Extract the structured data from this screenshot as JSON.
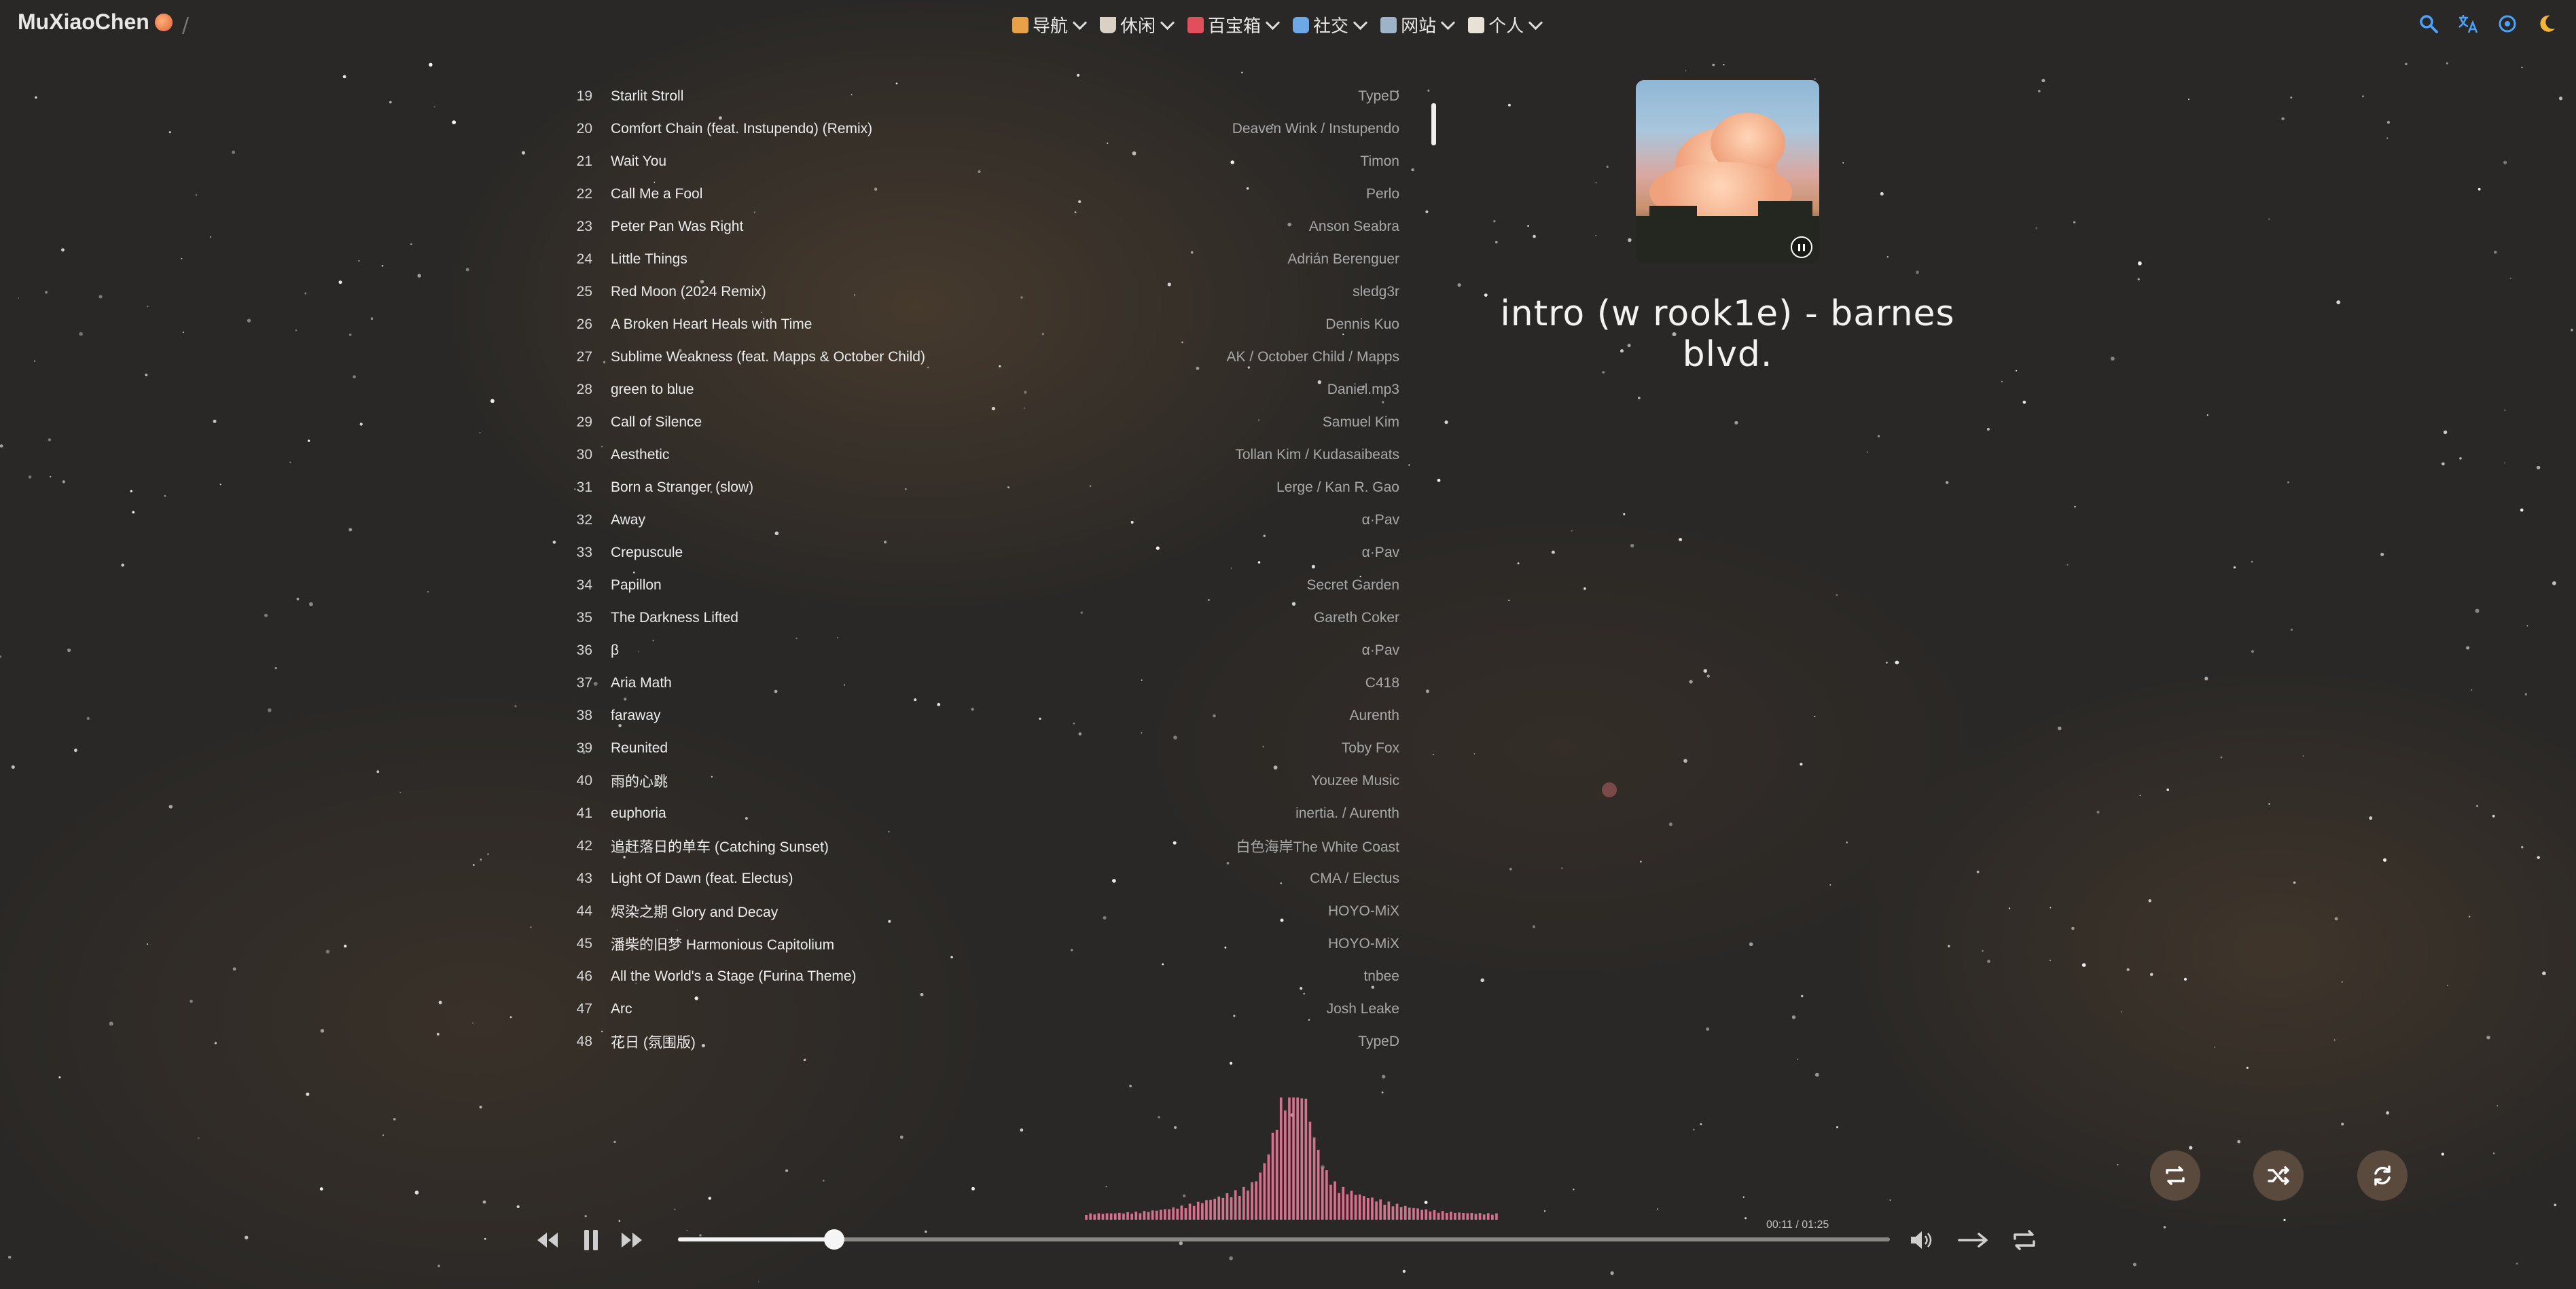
{
  "brand": {
    "name": "MuXiaoChen"
  },
  "nav": {
    "items": [
      {
        "label": "导航",
        "icon": "compass-icon"
      },
      {
        "label": "休闲",
        "icon": "coffee-icon"
      },
      {
        "label": "百宝箱",
        "icon": "gift-box-icon"
      },
      {
        "label": "社交",
        "icon": "chat-icon"
      },
      {
        "label": "网站",
        "icon": "website-icon"
      },
      {
        "label": "个人",
        "icon": "notebook-icon"
      }
    ],
    "right_icons": [
      "search-icon",
      "translate-icon",
      "settings-icon",
      "moon-icon"
    ]
  },
  "playlist": {
    "tracks": [
      {
        "n": "19",
        "title": "Starlit Stroll",
        "artist": "TypeD"
      },
      {
        "n": "20",
        "title": "Comfort Chain (feat. Instupendo) (Remix)",
        "artist": "Deaven Wink / Instupendo"
      },
      {
        "n": "21",
        "title": "Wait You",
        "artist": "Timon"
      },
      {
        "n": "22",
        "title": "Call Me a Fool",
        "artist": "Perlo"
      },
      {
        "n": "23",
        "title": "Peter Pan Was Right",
        "artist": "Anson Seabra"
      },
      {
        "n": "24",
        "title": "Little Things",
        "artist": "Adrián Berenguer"
      },
      {
        "n": "25",
        "title": "Red Moon (2024 Remix)",
        "artist": "sledg3r"
      },
      {
        "n": "26",
        "title": "A Broken Heart Heals with Time",
        "artist": "Dennis Kuo"
      },
      {
        "n": "27",
        "title": "Sublime Weakness (feat. Mapps & October Child)",
        "artist": "AK / October Child / Mapps"
      },
      {
        "n": "28",
        "title": "green to blue",
        "artist": "Daniel.mp3"
      },
      {
        "n": "29",
        "title": "Call of Silence",
        "artist": "Samuel Kim"
      },
      {
        "n": "30",
        "title": "Aesthetic",
        "artist": "Tollan Kim / Kudasaibeats"
      },
      {
        "n": "31",
        "title": "Born a Stranger (slow)",
        "artist": "Lerge / Kan R. Gao"
      },
      {
        "n": "32",
        "title": "Away",
        "artist": "α·Pav"
      },
      {
        "n": "33",
        "title": "Crepuscule",
        "artist": "α·Pav"
      },
      {
        "n": "34",
        "title": "Papillon",
        "artist": "Secret Garden"
      },
      {
        "n": "35",
        "title": "The Darkness Lifted",
        "artist": "Gareth Coker"
      },
      {
        "n": "36",
        "title": "β",
        "artist": "α·Pav"
      },
      {
        "n": "37",
        "title": "Aria Math",
        "artist": "C418"
      },
      {
        "n": "38",
        "title": "faraway",
        "artist": "Aurenth"
      },
      {
        "n": "39",
        "title": "Reunited",
        "artist": "Toby Fox"
      },
      {
        "n": "40",
        "title": "雨的心跳",
        "artist": "Youzee Music"
      },
      {
        "n": "41",
        "title": "euphoria",
        "artist": "inertia. / Aurenth"
      },
      {
        "n": "42",
        "title": "追赶落日的单车 (Catching Sunset)",
        "artist": "白色海岸The White Coast"
      },
      {
        "n": "43",
        "title": "Light Of Dawn (feat. Electus)",
        "artist": "CMA / Electus"
      },
      {
        "n": "44",
        "title": "烬染之期 Glory and Decay",
        "artist": "HOYO-MiX"
      },
      {
        "n": "45",
        "title": "潘柴的旧梦 Harmonious Capitolium",
        "artist": "HOYO-MiX"
      },
      {
        "n": "46",
        "title": "All the World's a Stage (Furina Theme)",
        "artist": "tnbee"
      },
      {
        "n": "47",
        "title": "Arc",
        "artist": "Josh Leake"
      },
      {
        "n": "48",
        "title": "花日 (氛围版)",
        "artist": "TypeD"
      }
    ]
  },
  "now_playing": {
    "title": "intro (w rook1e) - barnes blvd.",
    "current_time": "00:11",
    "total_time": "01:25",
    "progress_fraction": 0.129
  },
  "player": {
    "accent": "#e8799a",
    "controls": [
      "prev-icon",
      "pause-icon",
      "next-icon",
      "volume-icon",
      "order-arrow-icon",
      "loop-icon"
    ]
  },
  "round_buttons": [
    "repeat-icon",
    "shuffle-icon",
    "refresh-icon"
  ]
}
